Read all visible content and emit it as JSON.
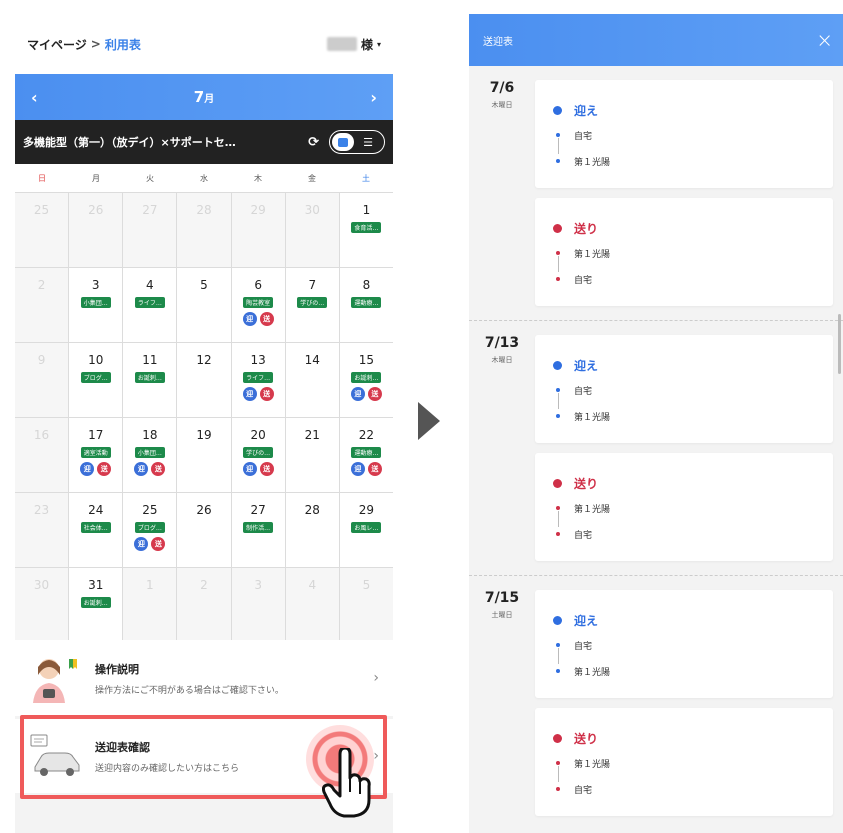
{
  "left": {
    "breadcrumb": {
      "home": "マイページ",
      "separator": ">",
      "current": "利用表"
    },
    "user_suffix": "様",
    "user_menu_icon": "caret-down-icon",
    "month": {
      "label": "7",
      "unit": "月",
      "prev": "‹",
      "next": "›"
    },
    "facility": {
      "name": "多機能型（第一）（放デイ）×サポートセ…",
      "refresh_icon": "refresh-icon",
      "view_icons": [
        "calendar-icon",
        "list-icon"
      ]
    },
    "weekdays": [
      "日",
      "月",
      "火",
      "水",
      "木",
      "金",
      "土"
    ],
    "weeks": [
      [
        {
          "n": "25",
          "o": true
        },
        {
          "n": "26",
          "o": true
        },
        {
          "n": "27",
          "o": true
        },
        {
          "n": "28",
          "o": true
        },
        {
          "n": "29",
          "o": true
        },
        {
          "n": "30",
          "o": true
        },
        {
          "n": "1",
          "tag": "食育活…"
        }
      ],
      [
        {
          "n": "2",
          "o": true
        },
        {
          "n": "3",
          "tag": "小集団…"
        },
        {
          "n": "4",
          "tag": "ライフ…"
        },
        {
          "n": "5"
        },
        {
          "n": "6",
          "tag": "陶芸教室",
          "badges": true
        },
        {
          "n": "7",
          "tag": "学びの…"
        },
        {
          "n": "8",
          "tag": "運動療…"
        }
      ],
      [
        {
          "n": "9",
          "o": true
        },
        {
          "n": "10",
          "tag": "ブログ…"
        },
        {
          "n": "11",
          "tag": "お誕刺…"
        },
        {
          "n": "12"
        },
        {
          "n": "13",
          "tag": "ライフ…",
          "badges": true
        },
        {
          "n": "14"
        },
        {
          "n": "15",
          "tag": "お誕刺…",
          "badges": true
        }
      ],
      [
        {
          "n": "16",
          "o": true
        },
        {
          "n": "17",
          "tag": "適室活動",
          "badges": true
        },
        {
          "n": "18",
          "tag": "小集団…",
          "badges": true
        },
        {
          "n": "19"
        },
        {
          "n": "20",
          "tag": "学びの…",
          "badges": true
        },
        {
          "n": "21"
        },
        {
          "n": "22",
          "tag": "運動療…",
          "badges": true
        }
      ],
      [
        {
          "n": "23",
          "o": true
        },
        {
          "n": "24",
          "tag": "社会体…"
        },
        {
          "n": "25",
          "tag": "ブログ…",
          "badges": true
        },
        {
          "n": "26"
        },
        {
          "n": "27",
          "tag": "制作活…"
        },
        {
          "n": "28"
        },
        {
          "n": "29",
          "tag": "お風レ…"
        }
      ],
      [
        {
          "n": "30",
          "o": true
        },
        {
          "n": "31",
          "tag": "お誕刺…"
        },
        {
          "n": "1",
          "o": true
        },
        {
          "n": "2",
          "o": true
        },
        {
          "n": "3",
          "o": true
        },
        {
          "n": "4",
          "o": true
        },
        {
          "n": "5",
          "o": true
        }
      ]
    ],
    "badge_labels": {
      "pickup": "迎",
      "dropoff": "送"
    },
    "help": {
      "title": "操作説明",
      "desc": "操作方法にご不明がある場合はご確認下さい。",
      "chevron": "›"
    },
    "transport": {
      "title": "送迎表確認",
      "desc": "送迎内容のみ確認したい方はこちら",
      "chevron": "›"
    },
    "colors": {
      "accent": "#4b8ff0",
      "tag_green": "#1d8a4a",
      "highlight_red": "#ef5a5a"
    }
  },
  "right": {
    "title": "送迎表",
    "close": "×",
    "days": [
      {
        "date": "7/6",
        "weekday": "木曜日",
        "trips": [
          {
            "kind": "迎え",
            "color": "blue",
            "stops": [
              "自宅",
              "第１光陽"
            ]
          },
          {
            "kind": "送り",
            "color": "red",
            "stops": [
              "第１光陽",
              "自宅"
            ]
          }
        ]
      },
      {
        "date": "7/13",
        "weekday": "木曜日",
        "trips": [
          {
            "kind": "迎え",
            "color": "blue",
            "stops": [
              "自宅",
              "第１光陽"
            ]
          },
          {
            "kind": "送り",
            "color": "red",
            "stops": [
              "第１光陽",
              "自宅"
            ]
          }
        ]
      },
      {
        "date": "7/15",
        "weekday": "土曜日",
        "trips": [
          {
            "kind": "迎え",
            "color": "blue",
            "stops": [
              "自宅",
              "第１光陽"
            ]
          },
          {
            "kind": "送り",
            "color": "red",
            "stops": [
              "第１光陽",
              "自宅"
            ]
          }
        ]
      }
    ]
  }
}
